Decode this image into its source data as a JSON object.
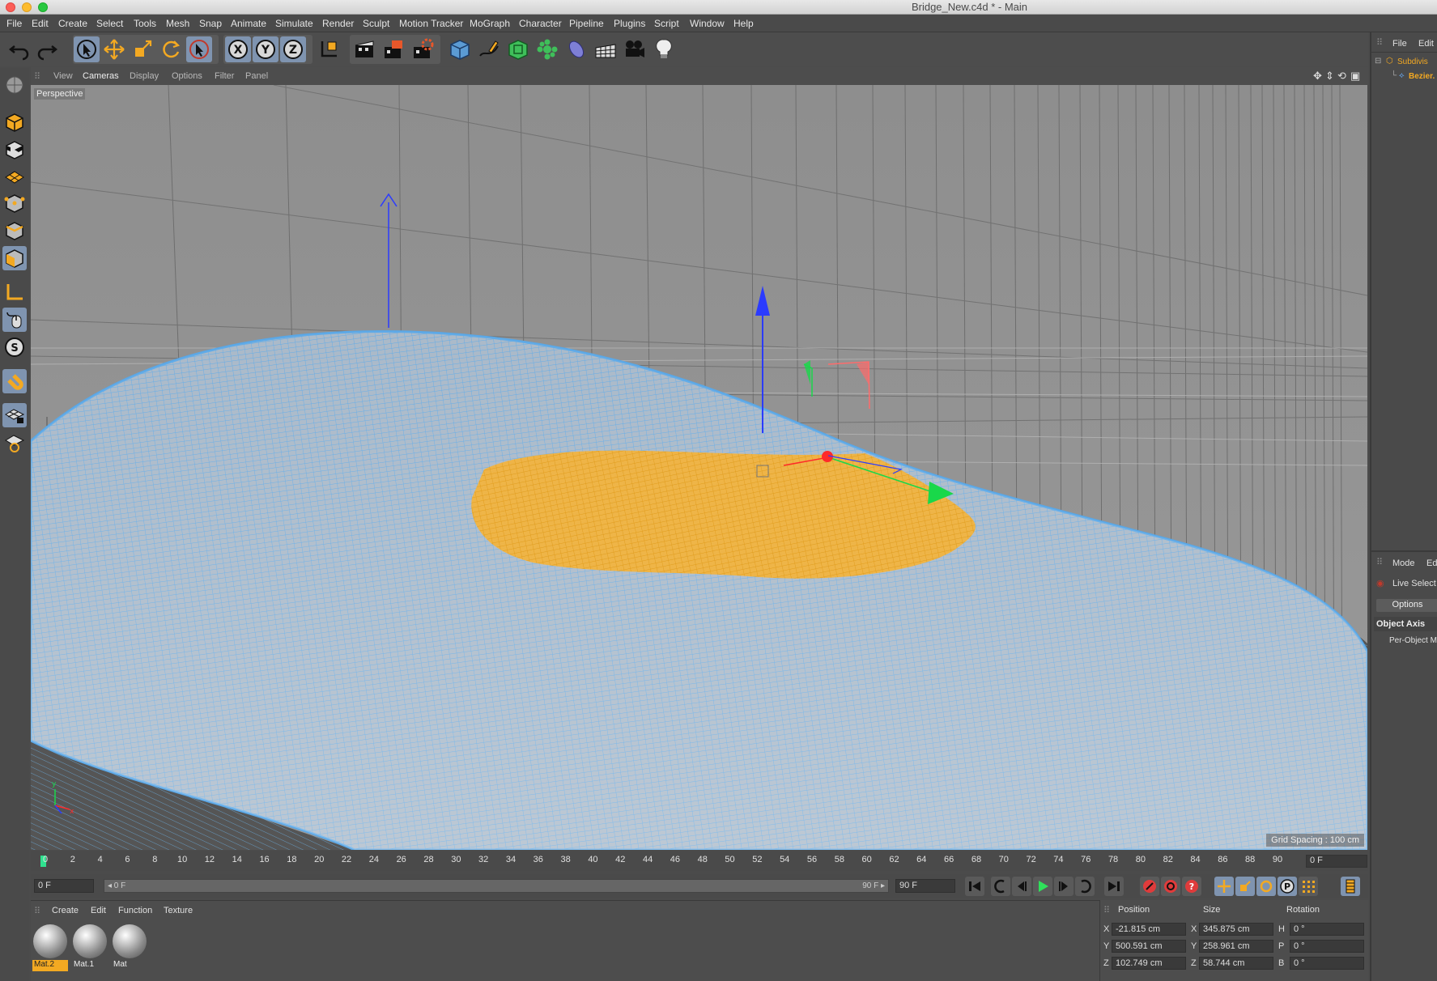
{
  "window": {
    "title": "Bridge_New.c4d * - Main"
  },
  "menu": [
    "File",
    "Edit",
    "Create",
    "Select",
    "Tools",
    "Mesh",
    "Snap",
    "Animate",
    "Simulate",
    "Render",
    "Sculpt",
    "Motion Tracker",
    "MoGraph",
    "Character",
    "Pipeline",
    "Plugins",
    "Script",
    "Window",
    "Help"
  ],
  "toolbar": {
    "icons": [
      "undo-icon",
      "redo-icon",
      "live-selection-icon",
      "move-icon",
      "scale-icon",
      "rotate-icon",
      "recent-tool-icon",
      "x-axis-lock-icon",
      "y-axis-lock-icon",
      "z-axis-lock-icon",
      "coordinate-system-icon",
      "render-view-icon",
      "render-picture-viewer-icon",
      "edit-render-settings-icon",
      "cube-primitive-icon",
      "pen-spline-icon",
      "subdivision-surface-icon",
      "cloner-icon",
      "deformer-icon",
      "floor-environment-icon",
      "camera-icon",
      "light-icon"
    ],
    "axis_labels": [
      "X",
      "Y",
      "Z"
    ]
  },
  "viewport": {
    "menus": [
      "View",
      "Cameras",
      "Display",
      "Options",
      "Filter",
      "Panel"
    ],
    "selected_menu": "Cameras",
    "camera_label": "Perspective",
    "grid_spacing": "Grid Spacing : 100 cm",
    "colors": {
      "background": "#8c8c8c",
      "mesh": "#5aa7e6",
      "selection": "#f3a922",
      "x_axis": "#ff2a2a",
      "y_axis": "#19d84a",
      "z_axis": "#2b3bff"
    }
  },
  "timeline": {
    "ticks": [
      "0",
      "2",
      "4",
      "6",
      "8",
      "10",
      "12",
      "14",
      "16",
      "18",
      "20",
      "22",
      "24",
      "26",
      "28",
      "30",
      "32",
      "34",
      "36",
      "38",
      "40",
      "42",
      "44",
      "46",
      "48",
      "50",
      "52",
      "54",
      "56",
      "58",
      "60",
      "62",
      "64",
      "66",
      "68",
      "70",
      "72",
      "74",
      "76",
      "78",
      "80",
      "82",
      "84",
      "86",
      "88",
      "90"
    ],
    "current_frame": "0 F"
  },
  "playback": {
    "start_field": "0 F",
    "range_start": "◂ 0 F",
    "range_end": "90 F ▸",
    "end_field": "90 F"
  },
  "material_manager": {
    "menus": [
      "Create",
      "Edit",
      "Function",
      "Texture"
    ],
    "materials": [
      {
        "name": "Mat.2",
        "selected": true
      },
      {
        "name": "Mat.1",
        "selected": false
      },
      {
        "name": "Mat",
        "selected": false
      }
    ]
  },
  "coordinates": {
    "headers": [
      "Position",
      "Size",
      "Rotation"
    ],
    "rows": [
      {
        "pos_label": "X",
        "pos": "-21.815 cm",
        "size_label": "X",
        "size": "345.875 cm",
        "rot_label": "H",
        "rot": "0 °"
      },
      {
        "pos_label": "Y",
        "pos": "500.591 cm",
        "size_label": "Y",
        "size": "258.961 cm",
        "rot_label": "P",
        "rot": "0 °"
      },
      {
        "pos_label": "Z",
        "pos": "102.749 cm",
        "size_label": "Z",
        "size": "58.744 cm",
        "rot_label": "B",
        "rot": "0 °"
      }
    ]
  },
  "object_manager": {
    "menus": [
      "File",
      "Edit"
    ],
    "objects": [
      "Subdivis",
      "Bezier."
    ]
  },
  "attributes": {
    "menus": [
      "Mode",
      "Ed"
    ],
    "tool_name": "Live Select",
    "tab": "Options",
    "section": "Object Axis",
    "option": "Per-Object M"
  }
}
